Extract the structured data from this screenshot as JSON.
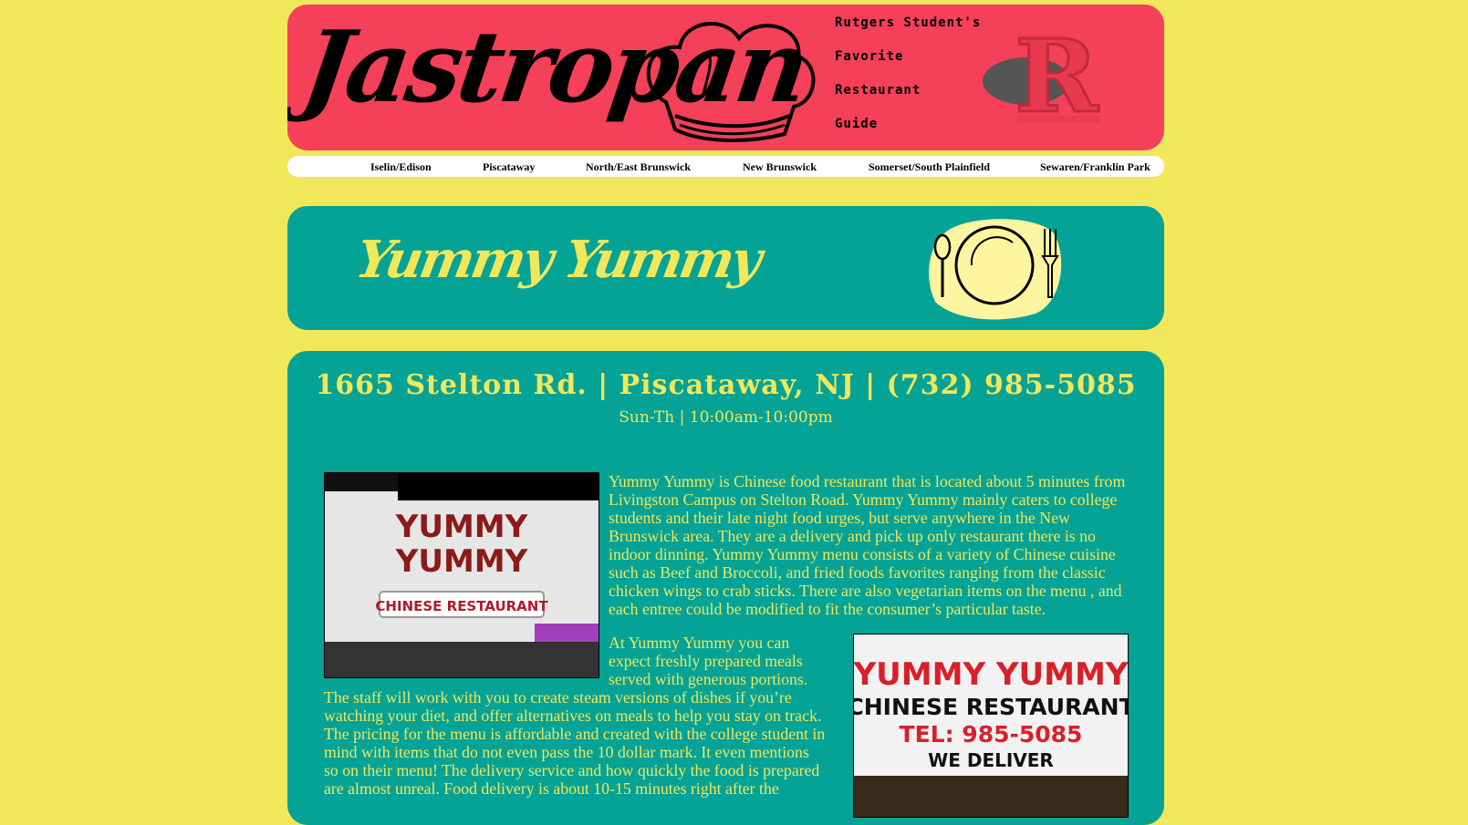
{
  "header": {
    "logo_text": "Jastropan",
    "tagline": [
      "Rutgers Student's",
      "Favorite",
      "Restaurant",
      "Guide"
    ],
    "brand_letter": "R"
  },
  "nav": {
    "items": [
      "Iselin/Edison",
      "Piscataway",
      "North/East Brunswick",
      "New Brunswick",
      "Somerset/South Plainfield",
      "Sewaren/Franklin Park"
    ]
  },
  "banner": {
    "title": "Yummy Yummy"
  },
  "content": {
    "address": "1665 Stelton Rd. | Piscataway, NJ | (732) 985-5085",
    "hours": "Sun-Th | 10:00am-10:00pm",
    "paragraphs": [
      "Yummy Yummy is Chinese food restaurant that is located about 5 minutes from Livingston Campus on Stelton Road. Yummy Yummy mainly caters to college students and their late night food urges, but serve anywhere in the New Brunswick area. They are a delivery and pick up only restaurant there is no indoor dinning. Yummy Yummy menu consists of a variety of Chinese cuisine such as Beef and Broccoli, and fried foods favorites ranging from the classic chicken wings to crab sticks. There are also vegetarian items on the menu , and each entree could be modified to fit the consumer’s particular taste.",
      "At Yummy Yummy you can expect freshly prepared meals served with generous portions. The staff will work with you to create steam versions of dishes if you’re watching your diet, and offer alternatives on meals to help you stay on track. The pricing for the menu is affordable and created with the college student in mind with items that do not even pass the 10 dollar mark. It even mentions so on their menu! The delivery service and how quickly the food is prepared are almost unreal. Food delivery is about 10-15 minutes right after the"
    ],
    "photo_1": {
      "sign_line_1": "YUMMY",
      "sign_line_2": "YUMMY",
      "sign_line_3": "CHINESE RESTAURANT"
    },
    "photo_2": {
      "sign_line_1": "YUMMY YUMMY",
      "sign_line_2": "CHINESE RESTAURANT",
      "sign_line_3": "TEL: 985-5085",
      "sign_line_4": "WE DELIVER"
    }
  },
  "colors": {
    "page_background": "#f0e85a",
    "header_background": "#f44058",
    "teal_panel": "#05a296",
    "accent_text": "#f0e85a"
  },
  "icons": [
    "chef-hat-icon",
    "rutgers-r-logo",
    "plate-utensils-icon"
  ]
}
